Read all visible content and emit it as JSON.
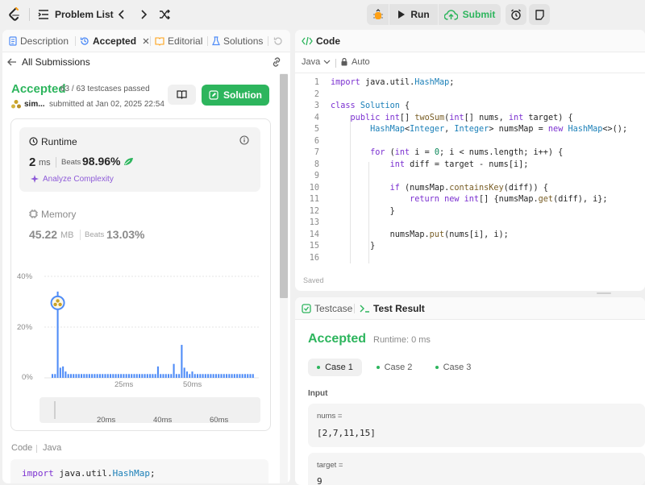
{
  "topbar": {
    "problem_list": "Problem List",
    "run_label": "Run",
    "submit_label": "Submit"
  },
  "left_tabs": {
    "description": "Description",
    "accepted": "Accepted",
    "editorial": "Editorial",
    "solutions": "Solutions"
  },
  "submission": {
    "back_label": "All Submissions",
    "status": "Accepted",
    "testcases": "63 / 63 testcases passed",
    "user": "sim...",
    "submitted": "submitted at Jan 02, 2025 22:54",
    "solution_button": "Solution"
  },
  "runtime": {
    "title": "Runtime",
    "value": "2",
    "unit": "ms",
    "beats_label": "Beats",
    "beats_value": "98.96%",
    "analyze": "Analyze Complexity"
  },
  "memory": {
    "title": "Memory",
    "value": "45.22",
    "unit": "MB",
    "beats_label": "Beats",
    "beats_value": "13.03%"
  },
  "chart_data": {
    "type": "bar",
    "y_ticks": [
      "40%",
      "20%",
      "0%"
    ],
    "ylim": [
      0,
      40
    ],
    "x_ticks": [
      "25ms",
      "50ms"
    ],
    "slider_ticks": [
      "20ms",
      "40ms",
      "60ms"
    ],
    "values": [
      1.5,
      1.5,
      34,
      4,
      4.5,
      2.5,
      1.5,
      1.5,
      1.5,
      1.5,
      1.5,
      1.5,
      1.5,
      1.5,
      1.5,
      1.5,
      1.5,
      1.5,
      1.5,
      1.5,
      1.5,
      1.5,
      1.5,
      1.5,
      1.5,
      1.5,
      1.5,
      1.5,
      1.5,
      1.5,
      1.5,
      1.5,
      1.5,
      1.5,
      1.5,
      1.5,
      1.5,
      1.5,
      1.5,
      1.5,
      4.5,
      1.5,
      1.5,
      1.5,
      1.5,
      1.5,
      5.5,
      1.5,
      1.5,
      13,
      4,
      2.5,
      1.5,
      2.5,
      1.5,
      1.5,
      1.5,
      1.5,
      1.5,
      1.5,
      1.5,
      1.5,
      1.5,
      1.5,
      1.5,
      1.5,
      1.5,
      1.5,
      1.5,
      1.5,
      1.5,
      1.5,
      1.5,
      1.5,
      1.5,
      1.5,
      1.5
    ],
    "highlight_index": 2,
    "colors": {
      "bar": "#4f8cf7",
      "grid": "#e5e5e5",
      "accent": "#2db55d"
    }
  },
  "code_footer": {
    "code_label": "Code",
    "lang_label": "Java",
    "preview_line": "import java.util.HashMap;"
  },
  "editor": {
    "title": "Code",
    "language": "Java",
    "auto_label": "Auto",
    "saved": "Saved",
    "lines": [
      {
        "n": "1",
        "t": "import java.util.HashMap;"
      },
      {
        "n": "2",
        "t": ""
      },
      {
        "n": "3",
        "t": "class Solution {"
      },
      {
        "n": "4",
        "t": "    public int[] twoSum(int[] nums, int target) {"
      },
      {
        "n": "5",
        "t": "        HashMap<Integer, Integer> numsMap = new HashMap<>();"
      },
      {
        "n": "6",
        "t": ""
      },
      {
        "n": "7",
        "t": "        for (int i = 0; i < nums.length; i++) {"
      },
      {
        "n": "8",
        "t": "            int diff = target - nums[i];"
      },
      {
        "n": "9",
        "t": ""
      },
      {
        "n": "10",
        "t": "            if (numsMap.containsKey(diff)) {"
      },
      {
        "n": "11",
        "t": "                return new int[] {numsMap.get(diff), i};"
      },
      {
        "n": "12",
        "t": "            }"
      },
      {
        "n": "13",
        "t": ""
      },
      {
        "n": "14",
        "t": "            numsMap.put(nums[i], i);"
      },
      {
        "n": "15",
        "t": "        }"
      },
      {
        "n": "16",
        "t": ""
      }
    ]
  },
  "result": {
    "testcase_tab": "Testcase",
    "result_tab": "Test Result",
    "status": "Accepted",
    "runtime": "Runtime: 0 ms",
    "cases": [
      "Case 1",
      "Case 2",
      "Case 3"
    ],
    "input_label": "Input",
    "nums_label": "nums =",
    "nums_value": "[2,7,11,15]",
    "target_label": "target =",
    "target_value": "9"
  }
}
